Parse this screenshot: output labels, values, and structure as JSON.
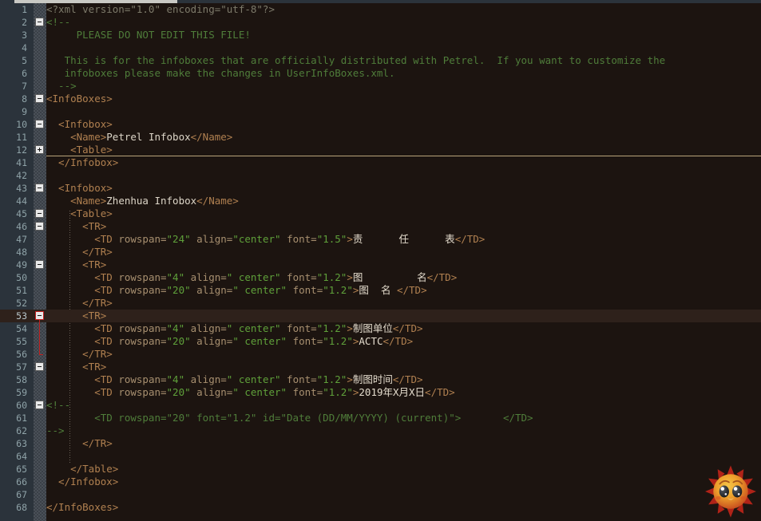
{
  "app": {
    "title": "PetrelInfoBoxes.xml",
    "editor_theme": "dark-brown",
    "colors": {
      "background": "#1c1410",
      "gutter": "#2b333b",
      "current_line": "#2e211b",
      "comment": "#4f7d3a",
      "tag": "#b08050",
      "attribute_value": "#5fa03a",
      "text_content": "#ddd6c8",
      "fold_rule": "#b9a47a",
      "fold_marker_active": "#c02020"
    }
  },
  "editor": {
    "current_line_number": 53,
    "collapsed_fold_after_line": 12,
    "active_fold_range": {
      "start": 53,
      "end": 56
    },
    "lines": [
      {
        "n": "1",
        "fold": "",
        "indent": 0,
        "parts": [
          {
            "c": "pi",
            "t": "<?xml version=\"1.0\" encoding=\"utf-8\"?>"
          }
        ]
      },
      {
        "n": "2",
        "fold": "minus",
        "indent": 0,
        "parts": [
          {
            "c": "cmt",
            "t": "<!--"
          }
        ]
      },
      {
        "n": "3",
        "fold": "",
        "indent": 0,
        "parts": [
          {
            "c": "cmt",
            "t": "     PLEASE DO NOT EDIT THIS FILE!"
          }
        ]
      },
      {
        "n": "4",
        "fold": "",
        "indent": 0,
        "parts": []
      },
      {
        "n": "5",
        "fold": "",
        "indent": 0,
        "parts": [
          {
            "c": "cmt",
            "t": "   This is for the infoboxes that are officially distributed with Petrel.  If you want to customize the"
          }
        ]
      },
      {
        "n": "6",
        "fold": "",
        "indent": 0,
        "parts": [
          {
            "c": "cmt",
            "t": "   infoboxes please make the changes in UserInfoBoxes.xml."
          }
        ]
      },
      {
        "n": "7",
        "fold": "",
        "indent": 0,
        "parts": [
          {
            "c": "cmt",
            "t": "  -->"
          }
        ]
      },
      {
        "n": "8",
        "fold": "minus",
        "indent": 0,
        "parts": [
          {
            "c": "tag",
            "t": "<InfoBoxes>"
          }
        ]
      },
      {
        "n": "9",
        "fold": "",
        "indent": 0,
        "parts": []
      },
      {
        "n": "10",
        "fold": "minus",
        "indent": 0,
        "parts": [
          {
            "c": "tag",
            "t": "  <Infobox>"
          }
        ]
      },
      {
        "n": "11",
        "fold": "",
        "indent": 0,
        "parts": [
          {
            "c": "tag",
            "t": "    <Name>"
          },
          {
            "c": "text",
            "t": "Petrel Infobox"
          },
          {
            "c": "tag",
            "t": "</Name>"
          }
        ]
      },
      {
        "n": "12",
        "fold": "plus",
        "indent": 0,
        "parts": [
          {
            "c": "tag",
            "t": "    <Table>"
          }
        ]
      },
      {
        "n": "41",
        "fold": "",
        "indent": 0,
        "parts": [
          {
            "c": "tag",
            "t": "  </Infobox>"
          }
        ]
      },
      {
        "n": "42",
        "fold": "",
        "indent": 0,
        "parts": []
      },
      {
        "n": "43",
        "fold": "minus",
        "indent": 0,
        "parts": [
          {
            "c": "tag",
            "t": "  <Infobox>"
          }
        ]
      },
      {
        "n": "44",
        "fold": "",
        "indent": 0,
        "parts": [
          {
            "c": "tag",
            "t": "    <Name>"
          },
          {
            "c": "text",
            "t": "Zhenhua Infobox"
          },
          {
            "c": "tag",
            "t": "</Name>"
          }
        ]
      },
      {
        "n": "45",
        "fold": "minus",
        "indent": 0,
        "parts": [
          {
            "c": "tag",
            "t": "    <Table>"
          }
        ]
      },
      {
        "n": "46",
        "fold": "minus",
        "indent": 0,
        "parts": [
          {
            "c": "tag",
            "t": "      <TR>"
          }
        ]
      },
      {
        "n": "47",
        "fold": "",
        "indent": 0,
        "parts": [
          {
            "c": "tag",
            "t": "        <TD "
          },
          {
            "c": "attr",
            "t": "rowspan="
          },
          {
            "c": "val",
            "t": "\"24\""
          },
          {
            "c": "attr",
            "t": " align="
          },
          {
            "c": "val",
            "t": "\"center\""
          },
          {
            "c": "attr",
            "t": " font="
          },
          {
            "c": "val",
            "t": "\"1.5\""
          },
          {
            "c": "tag",
            "t": ">"
          },
          {
            "c": "ctext",
            "t": "责      任      表"
          },
          {
            "c": "tag",
            "t": "</TD>"
          }
        ]
      },
      {
        "n": "48",
        "fold": "",
        "indent": 0,
        "parts": [
          {
            "c": "tag",
            "t": "      </TR>"
          }
        ]
      },
      {
        "n": "49",
        "fold": "minus",
        "indent": 0,
        "parts": [
          {
            "c": "tag",
            "t": "      <TR>"
          }
        ]
      },
      {
        "n": "50",
        "fold": "",
        "indent": 0,
        "parts": [
          {
            "c": "tag",
            "t": "        <TD "
          },
          {
            "c": "attr",
            "t": "rowspan="
          },
          {
            "c": "val",
            "t": "\"4\""
          },
          {
            "c": "attr",
            "t": " align="
          },
          {
            "c": "val",
            "t": "\" center\""
          },
          {
            "c": "attr",
            "t": " font="
          },
          {
            "c": "val",
            "t": "\"1.2\""
          },
          {
            "c": "tag",
            "t": ">"
          },
          {
            "c": "ctext",
            "t": "图         名"
          },
          {
            "c": "tag",
            "t": "</TD>"
          }
        ]
      },
      {
        "n": "51",
        "fold": "",
        "indent": 0,
        "parts": [
          {
            "c": "tag",
            "t": "        <TD "
          },
          {
            "c": "attr",
            "t": "rowspan="
          },
          {
            "c": "val",
            "t": "\"20\""
          },
          {
            "c": "attr",
            "t": " align="
          },
          {
            "c": "val",
            "t": "\" center\""
          },
          {
            "c": "attr",
            "t": " font="
          },
          {
            "c": "val",
            "t": "\"1.2\""
          },
          {
            "c": "tag",
            "t": ">"
          },
          {
            "c": "ctext",
            "t": "图  名 "
          },
          {
            "c": "tag",
            "t": "</TD>"
          }
        ]
      },
      {
        "n": "52",
        "fold": "",
        "indent": 0,
        "parts": [
          {
            "c": "tag",
            "t": "      </TR>"
          }
        ]
      },
      {
        "n": "53",
        "fold": "minus-red",
        "indent": 0,
        "parts": [
          {
            "c": "tag",
            "t": "      <TR>"
          }
        ]
      },
      {
        "n": "54",
        "fold": "",
        "indent": 0,
        "parts": [
          {
            "c": "tag",
            "t": "        <TD "
          },
          {
            "c": "attr",
            "t": "rowspan="
          },
          {
            "c": "val",
            "t": "\"4\""
          },
          {
            "c": "attr",
            "t": " align="
          },
          {
            "c": "val",
            "t": "\" center\""
          },
          {
            "c": "attr",
            "t": " font="
          },
          {
            "c": "val",
            "t": "\"1.2\""
          },
          {
            "c": "tag",
            "t": ">"
          },
          {
            "c": "ctext",
            "t": "制图单位"
          },
          {
            "c": "tag",
            "t": "</TD>"
          }
        ]
      },
      {
        "n": "55",
        "fold": "",
        "indent": 0,
        "parts": [
          {
            "c": "tag",
            "t": "        <TD "
          },
          {
            "c": "attr",
            "t": "rowspan="
          },
          {
            "c": "val",
            "t": "\"20\""
          },
          {
            "c": "attr",
            "t": " align="
          },
          {
            "c": "val",
            "t": "\" center\""
          },
          {
            "c": "attr",
            "t": " font="
          },
          {
            "c": "val",
            "t": "\"1.2\""
          },
          {
            "c": "tag",
            "t": ">"
          },
          {
            "c": "ctext",
            "t": "ACTC"
          },
          {
            "c": "tag",
            "t": "</TD>"
          }
        ]
      },
      {
        "n": "56",
        "fold": "",
        "indent": 0,
        "parts": [
          {
            "c": "tag",
            "t": "      </TR>"
          }
        ]
      },
      {
        "n": "57",
        "fold": "minus",
        "indent": 0,
        "parts": [
          {
            "c": "tag",
            "t": "      <TR>"
          }
        ]
      },
      {
        "n": "58",
        "fold": "",
        "indent": 0,
        "parts": [
          {
            "c": "tag",
            "t": "        <TD "
          },
          {
            "c": "attr",
            "t": "rowspan="
          },
          {
            "c": "val",
            "t": "\"4\""
          },
          {
            "c": "attr",
            "t": " align="
          },
          {
            "c": "val",
            "t": "\" center\""
          },
          {
            "c": "attr",
            "t": " font="
          },
          {
            "c": "val",
            "t": "\"1.2\""
          },
          {
            "c": "tag",
            "t": ">"
          },
          {
            "c": "ctext",
            "t": "制图时间"
          },
          {
            "c": "tag",
            "t": "</TD>"
          }
        ]
      },
      {
        "n": "59",
        "fold": "",
        "indent": 0,
        "parts": [
          {
            "c": "tag",
            "t": "        <TD "
          },
          {
            "c": "attr",
            "t": "rowspan="
          },
          {
            "c": "val",
            "t": "\"20\""
          },
          {
            "c": "attr",
            "t": " align="
          },
          {
            "c": "val",
            "t": "\" center\""
          },
          {
            "c": "attr",
            "t": " font="
          },
          {
            "c": "val",
            "t": "\"1.2\""
          },
          {
            "c": "tag",
            "t": ">"
          },
          {
            "c": "ctext",
            "t": "2019年X月X日"
          },
          {
            "c": "tag",
            "t": "</TD>"
          }
        ]
      },
      {
        "n": "60",
        "fold": "minus",
        "indent": 0,
        "parts": [
          {
            "c": "cmt",
            "t": "<!--"
          }
        ]
      },
      {
        "n": "61",
        "fold": "",
        "indent": 0,
        "parts": [
          {
            "c": "cmt",
            "t": "        <TD rowspan=\"20\" font=\"1.2\" id=\"Date (DD/MM/YYYY) (current)\">       </TD>"
          }
        ]
      },
      {
        "n": "62",
        "fold": "",
        "indent": 0,
        "parts": [
          {
            "c": "cmt",
            "t": "-->"
          }
        ]
      },
      {
        "n": "63",
        "fold": "",
        "indent": 0,
        "parts": [
          {
            "c": "tag",
            "t": "      </TR>"
          }
        ]
      },
      {
        "n": "64",
        "fold": "",
        "indent": 0,
        "parts": []
      },
      {
        "n": "65",
        "fold": "",
        "indent": 0,
        "parts": [
          {
            "c": "tag",
            "t": "    </Table>"
          }
        ]
      },
      {
        "n": "66",
        "fold": "",
        "indent": 0,
        "parts": [
          {
            "c": "tag",
            "t": "  </Infobox>"
          }
        ]
      },
      {
        "n": "67",
        "fold": "",
        "indent": 0,
        "parts": []
      },
      {
        "n": "68",
        "fold": "",
        "indent": 0,
        "parts": [
          {
            "c": "tag",
            "t": "</InfoBoxes>"
          }
        ]
      }
    ]
  },
  "mascot": {
    "name": "sun-emoticon",
    "description": "smiling sun with sparkling eyes",
    "body_color": "#e8a030",
    "ray_color": "#b02318",
    "mouth_color": "#e8a85a"
  }
}
